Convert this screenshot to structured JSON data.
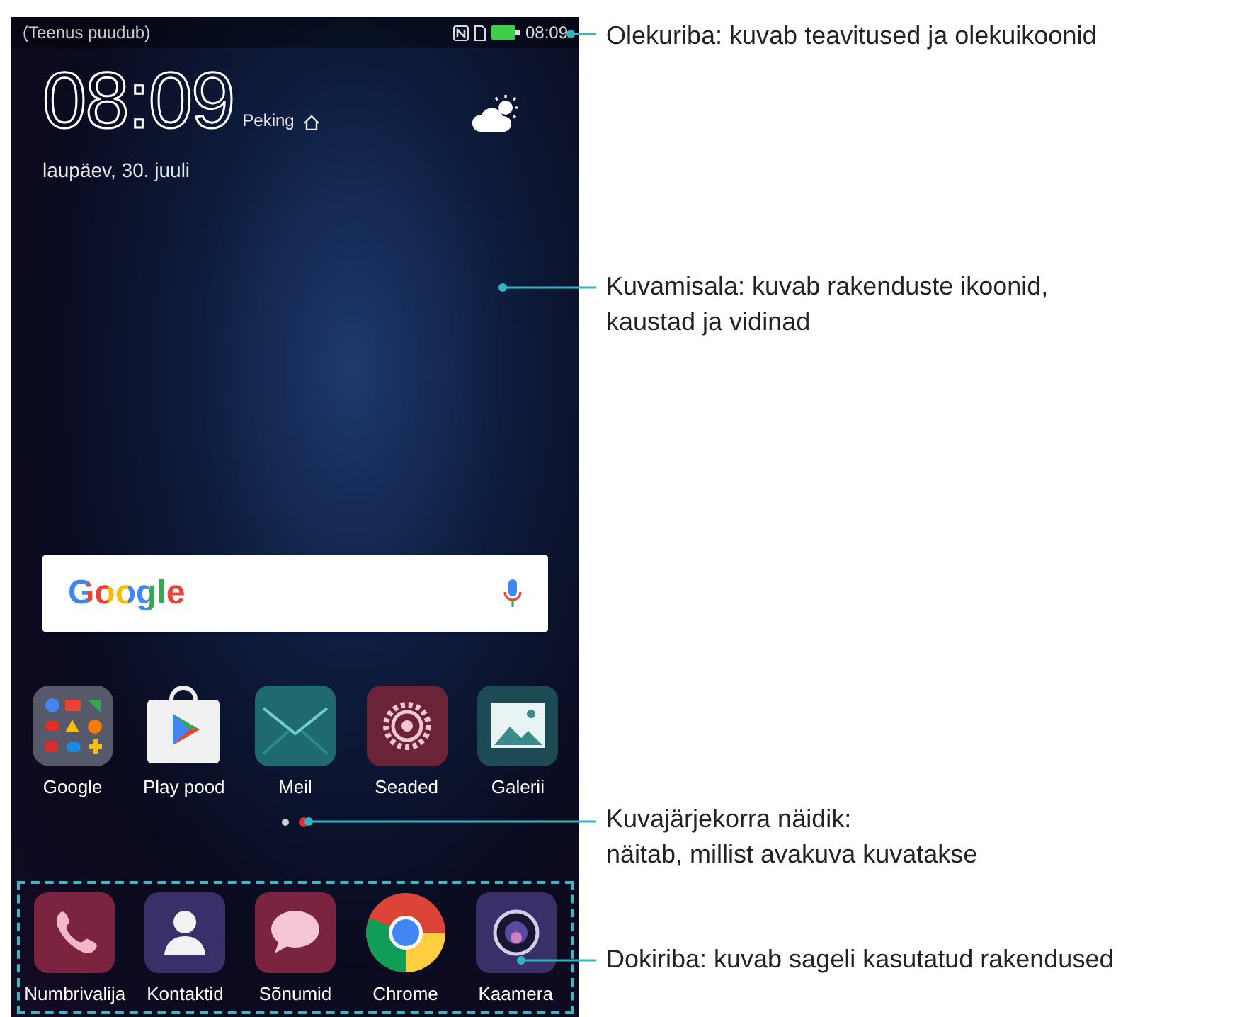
{
  "status_bar": {
    "carrier": "(Teenus puudub)",
    "time": "08:09"
  },
  "clock": {
    "time": "08:09",
    "city": "Peking",
    "date": "laupäev, 30. juuli"
  },
  "search": {
    "logo": "Google"
  },
  "apps": [
    {
      "label": "Google",
      "kind": "folder"
    },
    {
      "label": "Play pood",
      "kind": "store"
    },
    {
      "label": "Meil",
      "kind": "mail"
    },
    {
      "label": "Seaded",
      "kind": "settings"
    },
    {
      "label": "Galerii",
      "kind": "gallery"
    }
  ],
  "page_indicator": [
    {
      "selected": false
    },
    {
      "selected": true
    }
  ],
  "dock": [
    {
      "label": "Numbrivalija",
      "kind": "phone"
    },
    {
      "label": "Kontaktid",
      "kind": "contacts"
    },
    {
      "label": "Sõnumid",
      "kind": "messages"
    },
    {
      "label": "Chrome",
      "kind": "browser"
    },
    {
      "label": "Kaamera",
      "kind": "camera"
    }
  ],
  "callouts": [
    {
      "kind": "status_bar",
      "text": "Olekuriba: kuvab teavitused ja olekuikoonid"
    },
    {
      "kind": "screen_area",
      "text": "Kuvamisala: kuvab rakenduste ikoonid,\nkaustad ja vidinad"
    },
    {
      "kind": "page_indicator",
      "text": "Kuvajärjekorra näidik:\nnäitab, millist avakuva kuvatakse"
    },
    {
      "kind": "dock",
      "text": "Dokiriba: kuvab sageli kasutatud rakendused"
    }
  ]
}
